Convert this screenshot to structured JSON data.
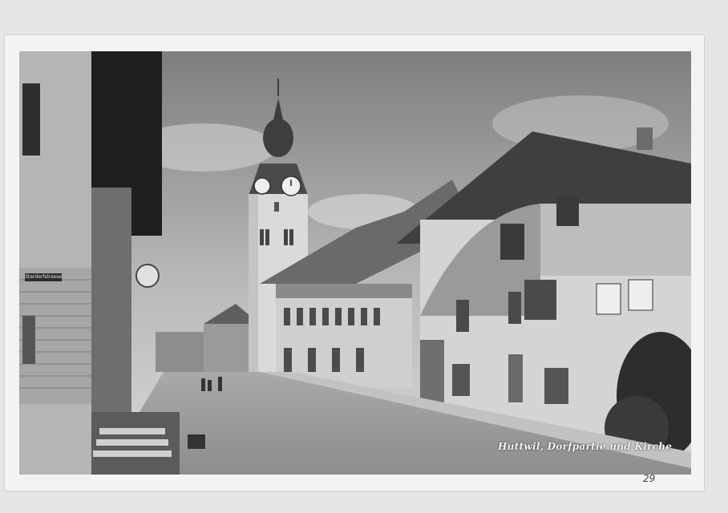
{
  "postcard": {
    "caption": "Huttwil, Dorfpartie und Kirche",
    "street_sign": "Stardorfstrasse",
    "pencil_note": "29"
  }
}
